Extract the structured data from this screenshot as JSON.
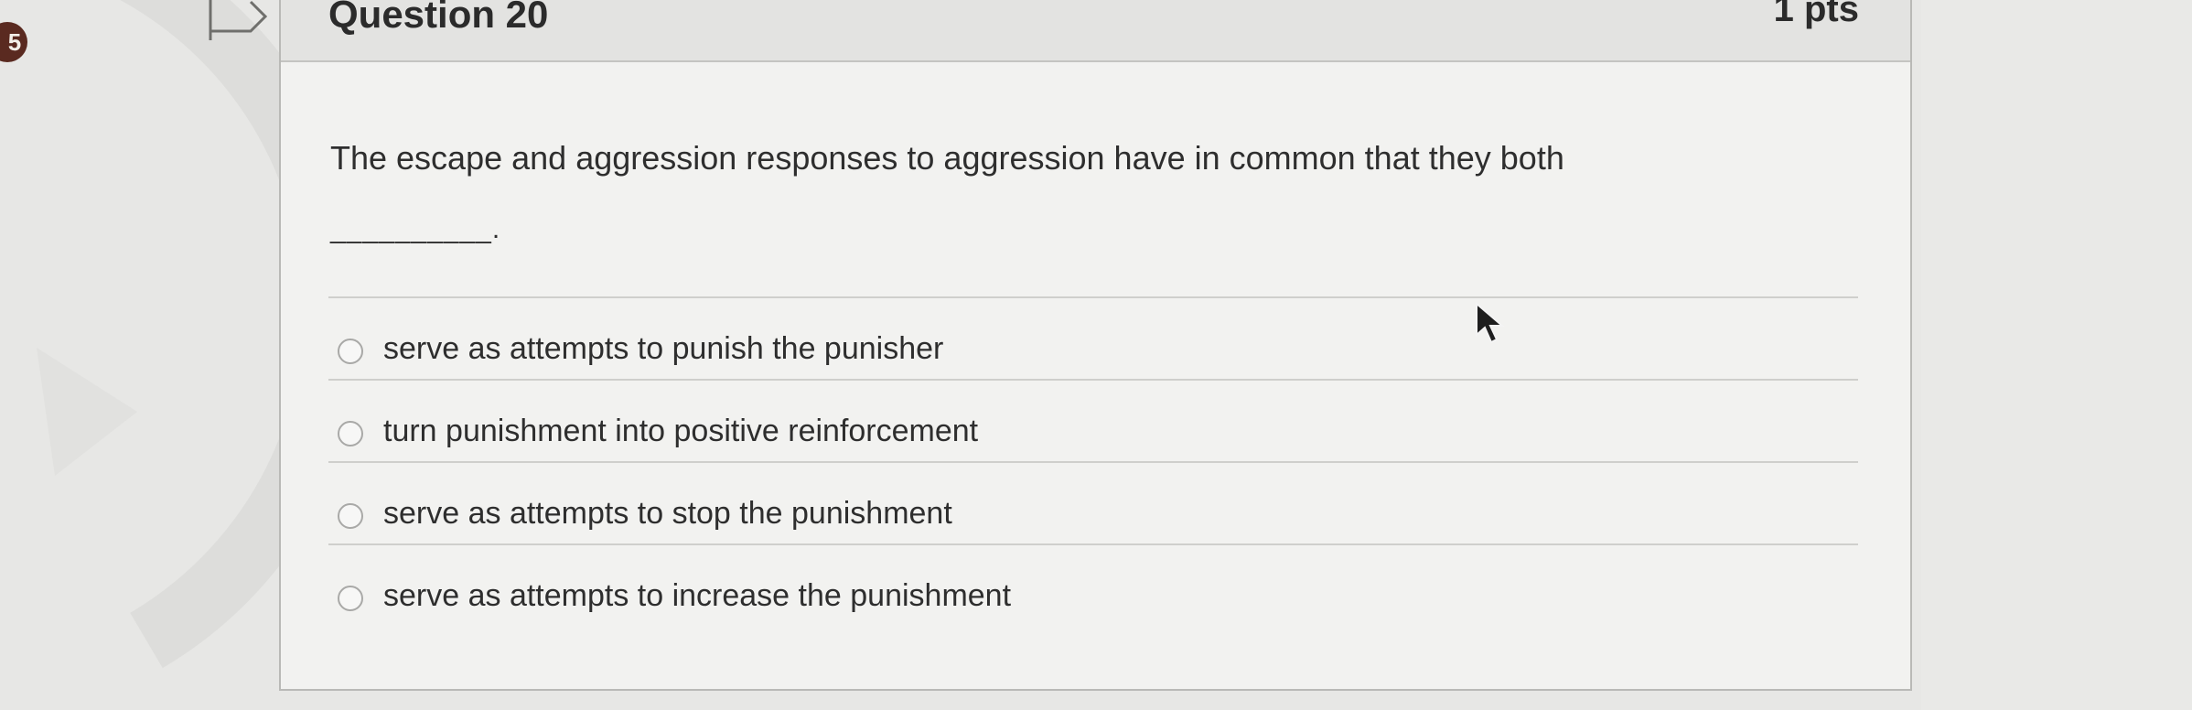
{
  "quiz": {
    "sidebar_question_number": "5",
    "question_title": "Question 20",
    "points": "1 pts",
    "question_text": "The escape and aggression responses to aggression have in common that they both",
    "blank": "__________.",
    "answers": [
      {
        "label": "serve as attempts to punish the punisher",
        "selected": false
      },
      {
        "label": "turn punishment into positive reinforcement",
        "selected": false
      },
      {
        "label": "serve as attempts to stop the punishment",
        "selected": false
      },
      {
        "label": "serve as attempts to increase the punishment",
        "selected": false
      }
    ]
  },
  "icons": {
    "flag": "flag-outline-icon",
    "cursor": "mouse-pointer-icon",
    "radio": "radio-unselected-icon"
  },
  "colors": {
    "page_background": "#e7e7e5",
    "card_background": "#f2f2f0",
    "header_background": "#e3e3e1",
    "badge": "#5a2a20",
    "text": "#2e2e2e"
  }
}
